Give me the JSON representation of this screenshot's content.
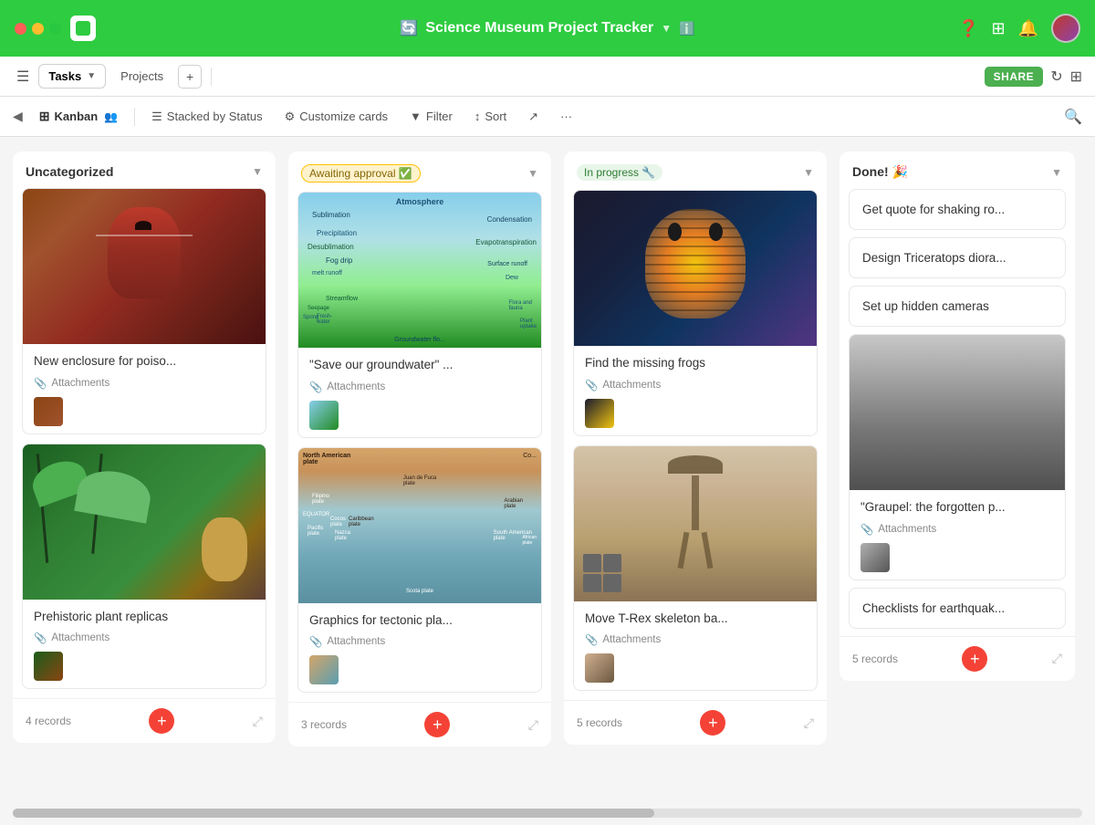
{
  "window": {
    "title": "Science Museum Project Tracker",
    "subtitle_icon": "🔄",
    "info_icon": "ℹ️"
  },
  "toolbar": {
    "tasks_label": "Tasks",
    "projects_label": "Projects",
    "share_label": "SHARE",
    "menu_icon": "☰"
  },
  "viewbar": {
    "kanban_label": "Kanban",
    "stacked_label": "Stacked by Status",
    "customize_label": "Customize cards",
    "filter_label": "Filter",
    "sort_label": "Sort"
  },
  "columns": [
    {
      "id": "uncategorized",
      "title": "Uncategorized",
      "records_count": "4 records",
      "cards": [
        {
          "title": "New enclosure for poiso...",
          "has_image": true,
          "img_class": "img-frog1",
          "thumb_class": "thumb-frog1",
          "attachments_label": "Attachments"
        },
        {
          "title": "Prehistoric plant replicas",
          "has_image": true,
          "img_class": "img-plant",
          "thumb_class": "thumb-plant",
          "attachments_label": "Attachments"
        }
      ]
    },
    {
      "id": "awaiting",
      "title": "Awaiting approval ✅",
      "status_class": "status-awaiting",
      "records_count": "3 records",
      "cards": [
        {
          "title": "\"Save our groundwater\" ...",
          "has_image": true,
          "img_class": "img-water-cycle",
          "thumb_class": "thumb-water",
          "attachments_label": "Attachments"
        },
        {
          "title": "Graphics for tectonic pla...",
          "has_image": true,
          "img_class": "img-tectonic",
          "thumb_class": "thumb-tect",
          "attachments_label": "Attachments"
        }
      ]
    },
    {
      "id": "inprogress",
      "title": "In progress 🔧",
      "records_count": "5 records",
      "cards": [
        {
          "title": "Find the missing frogs",
          "has_image": true,
          "img_class": "img-yellow-frog",
          "thumb_class": "thumb-frog2",
          "attachments_label": "Attachments"
        },
        {
          "title": "Move T-Rex skeleton ba...",
          "has_image": true,
          "img_class": "img-trex",
          "thumb_class": "thumb-trex",
          "attachments_label": "Attachments"
        }
      ]
    },
    {
      "id": "done",
      "title": "Done! 🎉",
      "records_count": "5 records",
      "simple_cards": [
        {
          "title": "Get quote for shaking ro..."
        },
        {
          "title": "Design Triceratops diora..."
        },
        {
          "title": "Set up hidden cameras"
        }
      ],
      "image_card": {
        "title": "\"Graupel: the forgotten p...",
        "img_class": "img-graupel",
        "thumb_class": "thumb-graupel",
        "attachments_label": "Attachments"
      },
      "last_card": {
        "title": "Checklists for earthquak..."
      }
    }
  ]
}
